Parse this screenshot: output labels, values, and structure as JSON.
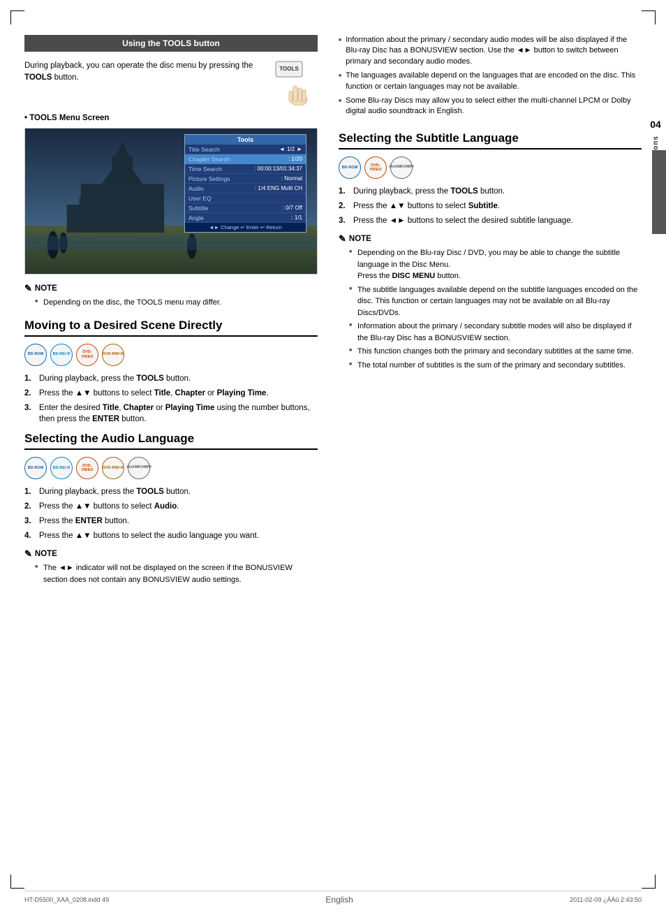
{
  "page": {
    "chapter_number": "04",
    "chapter_title": "Basic Functions",
    "language": "English",
    "footer_left": "HT-D5500_XAA_0208.indd   49",
    "footer_right": "2011-02-09   ¿ÀÀû 2:43:50"
  },
  "tools_section": {
    "header": "Using the TOOLS button",
    "intro_text": "During playback, you can operate the disc menu by pressing the TOOLS button.",
    "menu_screen_label": "TOOLS Menu Screen",
    "tools_menu": {
      "title": "Tools",
      "rows": [
        {
          "label": "Title Search",
          "separator": "◄",
          "value": "1/2",
          "arrow": "►",
          "highlighted": false
        },
        {
          "label": "Chapter Search",
          "separator": ":",
          "value": "1/20",
          "highlighted": true
        },
        {
          "label": "Time Search",
          "separator": ":",
          "value": "00:00:13/01:34:37",
          "highlighted": false
        },
        {
          "label": "Picture Settings",
          "separator": ":",
          "value": "Normal",
          "highlighted": false
        },
        {
          "label": "Audio",
          "separator": ":",
          "value": "1/4 ENG Multi CH",
          "highlighted": false
        },
        {
          "label": "User EQ",
          "separator": "",
          "value": "",
          "highlighted": false
        },
        {
          "label": "Subtitle",
          "separator": ":",
          "value": "0/7 Off",
          "highlighted": false
        },
        {
          "label": "Angle",
          "separator": ":",
          "value": "1/1",
          "highlighted": false
        }
      ],
      "footer": "◄► Change  ↵ Enter  ↩ Return"
    },
    "note": {
      "header": "NOTE",
      "items": [
        "Depending on the disc, the TOOLS menu may differ."
      ]
    }
  },
  "moving_section": {
    "heading": "Moving to a Desired Scene Directly",
    "badges": [
      "BD-ROM",
      "BD-RE/-R",
      "DVD-VIDEO",
      "DVD-RW/-R"
    ],
    "steps": [
      {
        "num": "1.",
        "text": "During playback, press the TOOLS button."
      },
      {
        "num": "2.",
        "text": "Press the ▲▼ buttons to select Title, Chapter or Playing Time."
      },
      {
        "num": "3.",
        "text": "Enter the desired Title, Chapter or Playing Time using the number buttons, then press the ENTER button."
      }
    ]
  },
  "audio_language_section": {
    "heading": "Selecting the Audio Language",
    "badges": [
      "BD-ROM",
      "BD-RE/-R",
      "DVD-VIDEO",
      "DVD-RW/-R",
      "DivX/MKV/MP4"
    ],
    "steps": [
      {
        "num": "1.",
        "text": "During playback, press the TOOLS button."
      },
      {
        "num": "2.",
        "text": "Press the ▲▼ buttons to select Audio."
      },
      {
        "num": "3.",
        "text": "Press the ENTER button."
      },
      {
        "num": "4.",
        "text": "Press the ▲▼ buttons to select the audio language you want."
      }
    ],
    "note": {
      "header": "NOTE",
      "items": [
        "The ◄► indicator will not be displayed on the screen if the BONUSVIEW section does not contain any BONUSVIEW audio settings."
      ]
    }
  },
  "right_top_bullets": [
    "Information about the primary / secondary audio modes will be also displayed if the Blu-ray Disc has a BONUSVIEW section. Use the ◄► button to switch between primary and secondary audio modes.",
    "The languages available depend on the languages that are encoded on the disc. This function or certain languages may not be available.",
    "Some Blu-ray Discs may allow you to select either the multi-channel LPCM or Dolby digital audio soundtrack in English."
  ],
  "subtitle_section": {
    "heading": "Selecting the Subtitle Language",
    "badges": [
      "BD-ROM",
      "DVD-VIDEO",
      "DivX/MKV/MP4"
    ],
    "steps": [
      {
        "num": "1.",
        "text": "During playback, press the TOOLS button."
      },
      {
        "num": "2.",
        "text": "Press the ▲▼ buttons to select Subtitle."
      },
      {
        "num": "3.",
        "text": "Press the ◄► buttons to select the desired subtitle language."
      }
    ],
    "note": {
      "header": "NOTE",
      "items": [
        "Depending on the Blu-ray Disc / DVD, you may be able to change the subtitle language in the Disc Menu. Press the DISC MENU button.",
        "The subtitle languages available depend on the subtitle languages encoded on the disc. This function or certain languages may not be available on all Blu-ray Discs/DVDs.",
        "Information about the primary / secondary subtitle modes will also be displayed if the Blu-ray Disc has a BONUSVIEW section.",
        "This function changes both the primary and secondary subtitles at the same time.",
        "The total number of subtitles is the sum of the primary and secondary subtitles."
      ]
    }
  }
}
